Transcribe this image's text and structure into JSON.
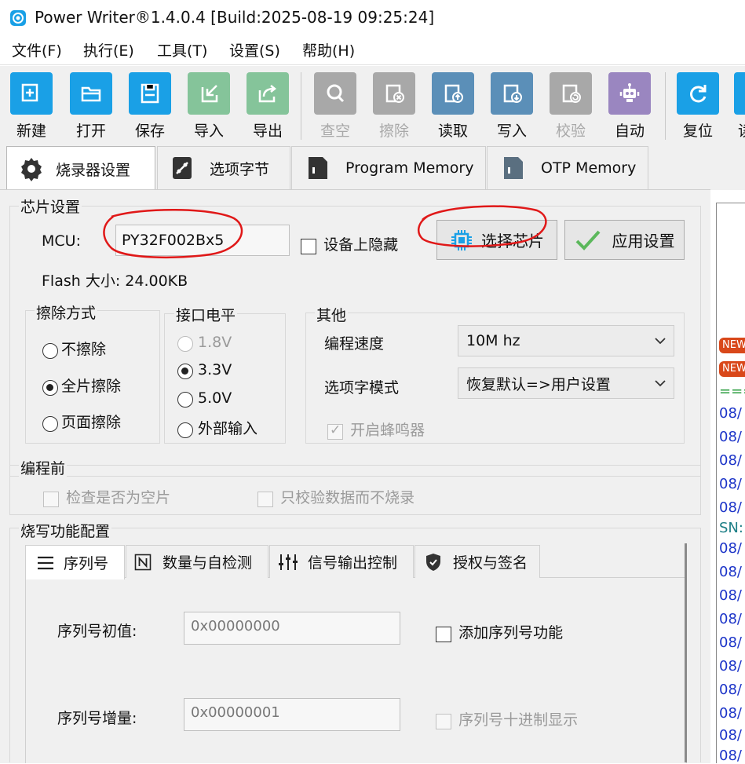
{
  "window": {
    "title": "Power Writer®1.4.0.4 [Build:2025-08-19 09:25:24]"
  },
  "menu": [
    "文件(F)",
    "执行(E)",
    "工具(T)",
    "设置(S)",
    "帮助(H)"
  ],
  "toolbar": {
    "new": "新建",
    "open": "打开",
    "save": "保存",
    "import": "导入",
    "export": "导出",
    "check_blank": "查空",
    "erase": "擦除",
    "read": "读取",
    "write": "写入",
    "verify": "校验",
    "auto": "自动",
    "reset": "复位",
    "cut": "读"
  },
  "tabs": [
    "烧录器设置",
    "选项字节",
    "Program Memory",
    "OTP Memory"
  ],
  "chip": {
    "group_label": "芯片设置",
    "mcu_label": "MCU:",
    "mcu_value": "PY32F002Bx5",
    "hide_on_device": "设备上隐藏",
    "select_chip": "选择芯片",
    "apply_settings": "应用设置",
    "flash_size": "Flash 大小: 24.00KB"
  },
  "erase": {
    "label": "擦除方式",
    "options": [
      "不擦除",
      "全片擦除",
      "页面擦除"
    ],
    "selected": "全片擦除"
  },
  "voltage": {
    "label": "接口电平",
    "options": [
      "1.8V",
      "3.3V",
      "5.0V",
      "外部输入"
    ],
    "selected": "3.3V"
  },
  "other": {
    "label": "其他",
    "speed_label": "编程速度",
    "speed_value": "10M hz",
    "ob_mode_label": "选项字模式",
    "ob_mode_value": "恢复默认=>用户设置",
    "buzzer_label": "开启蜂鸣器"
  },
  "pre_program": {
    "label": "编程前",
    "check_blank": "检查是否为空片",
    "verify_only": "只校验数据而不烧录"
  },
  "burn_config": {
    "label": "烧写功能配置",
    "tabs": [
      "序列号",
      "数量与自检测",
      "信号输出控制",
      "授权与签名"
    ],
    "serial_init_label": "序列号初值:",
    "serial_init_value": "0x00000000",
    "serial_inc_label": "序列号增量:",
    "serial_inc_value": "0x00000001",
    "add_serial": "添加序列号功能",
    "decimal_display": "序列号十进制显示"
  },
  "log": {
    "badge": "NEW",
    "separator": "===",
    "lines": [
      "08/",
      "08/",
      "08/",
      "08/",
      "08/",
      "SN:",
      "08/",
      "08/",
      "08/",
      "08/",
      "08/",
      "08/",
      "08/",
      "08/",
      "08/",
      "08/"
    ]
  },
  "colors": {
    "accent": "#1aa0e6",
    "red_annotation": "#e01818",
    "log_blue": "#1c34c8",
    "log_teal": "#1d7f86"
  }
}
